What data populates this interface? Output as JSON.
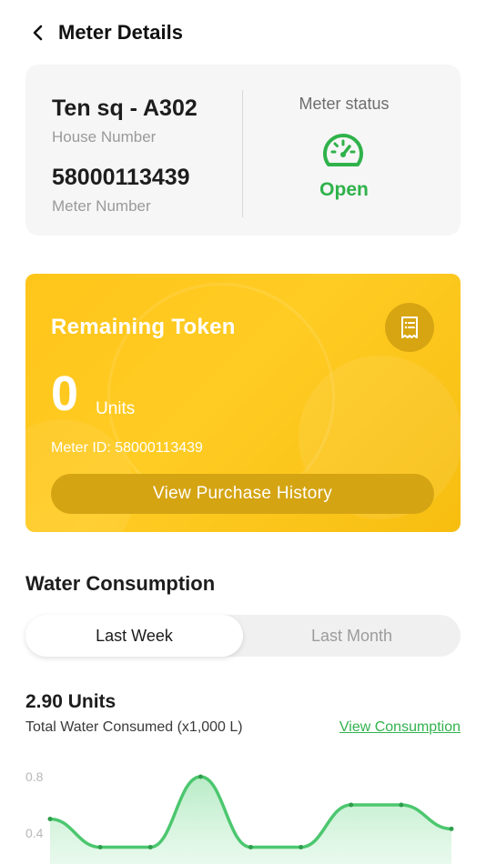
{
  "header": {
    "title": "Meter Details"
  },
  "meter_info": {
    "house_number": "Ten sq - A302",
    "house_label": "House Number",
    "meter_number": "58000113439",
    "meter_label": "Meter Number",
    "status_label": "Meter status",
    "status_value": "Open",
    "status_color": "#2fb24a"
  },
  "token": {
    "title": "Remaining Token",
    "value": "0",
    "unit": "Units",
    "meter_id_label": "Meter ID:",
    "meter_id": "58000113439",
    "history_button": "View Purchase History",
    "card_color": "#ffc51a"
  },
  "consumption": {
    "title": "Water Consumption",
    "tabs": [
      {
        "label": "Last Week",
        "active": true
      },
      {
        "label": "Last Month",
        "active": false
      }
    ],
    "total": "2.90 Units",
    "caption": "Total Water Consumed (x1,000 L)",
    "link": "View Consumption",
    "accent_color": "#33b24e"
  },
  "chart_data": {
    "type": "area",
    "yticks": [
      "0.8",
      "0.4"
    ],
    "ylim": [
      0,
      0.9
    ],
    "values": [
      0.5,
      0.3,
      0.3,
      0.8,
      0.3,
      0.3,
      0.6,
      0.6,
      0.43
    ],
    "line_color": "#4cc76f"
  }
}
